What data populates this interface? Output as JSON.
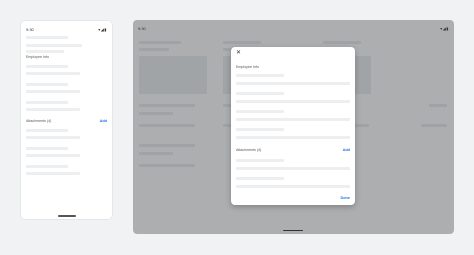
{
  "phone": {
    "status_time": "9:30",
    "status_icons": "▾◢▮",
    "section_employee": "Employee Info",
    "section_attachments": "Attachments (4)",
    "add_label": "Add"
  },
  "tablet": {
    "status_time": "9:30",
    "status_icons": "▾◢▮",
    "dialog": {
      "close_glyph": "✕",
      "section_employee": "Employee Info",
      "section_attachments": "Attachments (4)",
      "add_label": "Add",
      "done_label": "Done"
    }
  },
  "colors": {
    "accent": "#1a73e8",
    "skeleton": "#eceef0",
    "scrim": "#5f6368"
  }
}
